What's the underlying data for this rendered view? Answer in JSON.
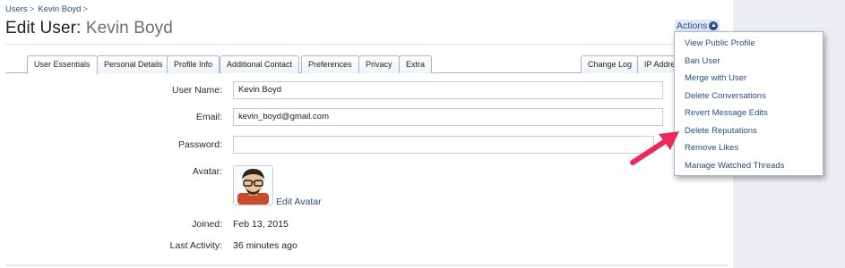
{
  "breadcrumb": {
    "items": [
      "Users",
      "Kevin Boyd"
    ],
    "separator": ">"
  },
  "title": {
    "prefix": "Edit User:",
    "user": "Kevin Boyd"
  },
  "actions": {
    "label": "Actions",
    "caret": "▲"
  },
  "tabs": [
    {
      "label": "User Essentials",
      "active": true
    },
    {
      "label": "Personal Details"
    },
    {
      "label": "Profile Info"
    },
    {
      "label": "Additional Contact"
    },
    {
      "label": "Preferences"
    },
    {
      "label": "Privacy"
    },
    {
      "label": "Extra"
    },
    {
      "label": "Change Log"
    },
    {
      "label": "IP Addre"
    }
  ],
  "form": {
    "username_label": "User Name:",
    "username_value": "Kevin Boyd",
    "email_label": "Email:",
    "email_value": "kevin_boyd@gmail.com",
    "password_label": "Password:",
    "password_value": "",
    "avatar_label": "Avatar:",
    "edit_avatar_label": "Edit Avatar",
    "joined_label": "Joined:",
    "joined_value": "Feb 13, 2015",
    "last_activity_label": "Last Activity:",
    "last_activity_value": "36 minutes ago"
  },
  "menu": {
    "items": [
      "View Public Profile",
      "Ban User",
      "Merge with User",
      "Delete Conversations",
      "Revert Message Edits",
      "Delete Reputations",
      "Remove Likes",
      "Manage Watched Threads"
    ]
  },
  "colors": {
    "link": "#2a4c87",
    "arrow": "#ec2a5e",
    "sidebar": "#eceef2"
  },
  "icons": {
    "actions_caret": "chevron-up-icon",
    "avatar": "avatar-image",
    "annotation": "pointer-arrow"
  }
}
